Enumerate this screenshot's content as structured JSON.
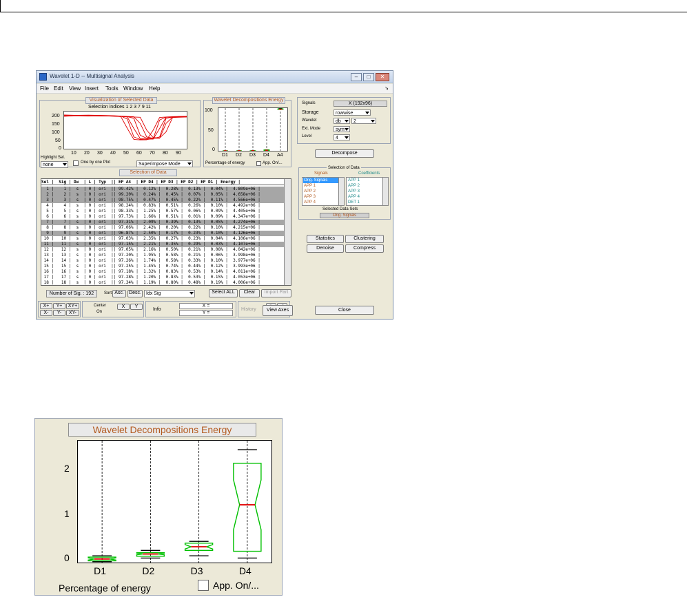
{
  "window": {
    "title": "Wavelet 1-D -- Multisignal Analysis",
    "controls": [
      "–",
      "□",
      "✕"
    ],
    "menu": [
      "File",
      "Edit",
      "View",
      "Insert",
      "Tools",
      "Window",
      "Help"
    ],
    "menu_corner": "↘"
  },
  "visualization": {
    "title": "Visualization of Selected Data",
    "indices_label": "Selection indices 1  2  3  7  9 11",
    "y_ticks": [
      "200",
      "150",
      "100",
      "50",
      "0"
    ],
    "x_ticks": [
      "10",
      "20",
      "30",
      "40",
      "50",
      "60",
      "70",
      "80",
      "90"
    ],
    "highlight_label": "Highlight Sel.",
    "highlight_value": "none",
    "one_by_one_label": "One by one Plot",
    "mode_value": "Superimpose Mode"
  },
  "energy_small": {
    "title": "Wavelet Decompositions Energy",
    "y_ticks": [
      "100",
      "50",
      "0"
    ],
    "x_ticks": [
      "D1",
      "D2",
      "D3",
      "D4",
      "A4"
    ],
    "xlabel": "Percentage of energy",
    "app_label": "App. On/..."
  },
  "data_selection": {
    "title": "Selection of Data",
    "header": "Sel |  Sig | Dw  | L | Typ  || EP A4  | EP D4 | EP D3 | EP D2 | EP D1 | Energy |",
    "rows": [
      {
        "text": "  1 |    1 |  s  | 0 | ori  || 99.42% |  0.12% |  0.28% |  0.13% |  0.04% |  4.809e+06 |",
        "sel": true
      },
      {
        "text": "  2 |    2 |  s  | 0 | ori  || 99.20% |  0.24% |  0.45% |  0.07% |  0.05% |  4.658e+06 |",
        "sel": true
      },
      {
        "text": "  3 |    3 |  s  | 0 | ori  || 98.75% |  0.47% |  0.45% |  0.22% |  0.11% |  4.566e+06 |",
        "sel": true
      },
      {
        "text": "  4 |    4 |  s  | 0 | ori  || 98.24% |  0.83% |  0.51% |  0.26% |  0.10% |  4.492e+06 |",
        "sel": false
      },
      {
        "text": "  5 |    5 |  s  | 0 | ori  || 98.33% |  1.25% |  0.57% |  0.06% |  0.09% |  4.405e+06 |",
        "sel": false
      },
      {
        "text": "  6 |    6 |  s  | 0 | ori  || 97.73% |  1.66% |  0.51% |  0.01% |  0.09% |  4.347e+06 |",
        "sel": false
      },
      {
        "text": "  7 |    7 |  s  | 0 | ori  || 97.31% |  2.09% |  0.39% |  0.13% |  0.05% |  4.274e+06 |",
        "sel": true
      },
      {
        "text": "  8 |    8 |  s  | 0 | ori  || 97.06% |  2.42% |  0.20% |  0.22% |  0.10% |  4.215e+06 |",
        "sel": false
      },
      {
        "text": "  9 |    9 |  s  | 0 | ori  || 96.87% |  2.50% |  0.17% |  0.23% |  0.10% |  4.126e+06 |",
        "sel": true
      },
      {
        "text": " 10 |   10 |  s  | 0 | ori  || 97.03% |  2.35% |  0.27% |  0.23% |  0.04% |  4.106e+06 |",
        "sel": false
      },
      {
        "text": " 11 |   11 |  s  | 0 | ori  || 97.15% |  2.21% |  0.35% |  0.29% |  0.03% |  4.107e+06 |",
        "sel": true
      },
      {
        "text": " 12 |   12 |  s  | 0 | ori  || 97.05% |  2.16% |  0.50% |  0.21% |  0.08% |  4.042e+06 |",
        "sel": false
      },
      {
        "text": " 13 |   13 |  s  | 0 | ori  || 97.20% |  1.95% |  0.58% |  0.21% |  0.06% |  3.998e+06 |",
        "sel": false
      },
      {
        "text": " 14 |   14 |  s  | 0 | ori  || 97.26% |  1.74% |  0.58% |  0.33% |  0.10% |  3.977e+06 |",
        "sel": false
      },
      {
        "text": " 15 |   15 |  s  | 0 | ori  || 97.25% |  1.45% |  0.74% |  0.44% |  0.12% |  3.993e+06 |",
        "sel": false
      },
      {
        "text": " 16 |   16 |  s  | 0 | ori  || 97.18% |  1.32% |  0.83% |  0.53% |  0.14% |  4.011e+06 |",
        "sel": false
      },
      {
        "text": " 17 |   17 |  s  | 0 | ori  || 97.28% |  1.20% |  0.83% |  0.53% |  0.15% |  4.053e+06 |",
        "sel": false
      },
      {
        "text": " 18 |   18 |  s  | 0 | ori  || 97.34% |  1.19% |  0.80% |  0.48% |  0.19% |  4.006e+06 |",
        "sel": false
      }
    ],
    "num_sig_label": "Number of Sig. : 192",
    "sort_label": "Sort",
    "asc_label": "Asc.",
    "desc_label": "Desc.",
    "sort_value": "Idx Sig",
    "select_all": "Select ALL",
    "clear": "Clear",
    "import_part": "Import Part"
  },
  "bottom_tools": {
    "xplus": "X+",
    "yplus": "Y+",
    "xyplus": "XY+",
    "xminus": "X-",
    "yminus": "Y-",
    "xyminus": "XY-",
    "center_label": "Center",
    "center_sub": "On",
    "c_x": "X",
    "c_y": "Y",
    "info_label": "Info",
    "info_x": "X =",
    "info_y": "Y =",
    "history_label": "History",
    "hist_back": "<-",
    "hist_fwd": "->",
    "hist_all": "<<-",
    "view_axes": "View Axes"
  },
  "right_panel": {
    "signals_label": "Signals",
    "signals_value": "X (192x96)",
    "storage_label": "Storage",
    "storage_value": "rowwise",
    "wavelet_label": "Wavelet",
    "wavelet_family": "db",
    "wavelet_number": "2",
    "extmode_label": "Ext. Mode",
    "extmode_value": "sym",
    "level_label": "Level",
    "level_value": "4",
    "decompose": "Decompose",
    "selection_title": "Selection of Data",
    "signals_col": "Signals",
    "coeffs_col": "Coefficients",
    "signals_list": [
      "Orig. Signals",
      "APP 1",
      "APP 2",
      "APP 3",
      "APP 4"
    ],
    "coeffs_list": [
      "APP 1",
      "APP 2",
      "APP 3",
      "APP 4",
      "DET 1"
    ],
    "selected_sets_label": "Selected Data Sets",
    "selected_sets_value": "Orig. Signals",
    "statistics": "Statistics",
    "clustering": "Clustering",
    "denoise": "Denoise",
    "compress": "Compress",
    "close": "Close"
  },
  "energy_zoom": {
    "title": "Wavelet Decompositions Energy",
    "y_ticks": [
      "2",
      "1",
      "0"
    ],
    "x_ticks": [
      "D1",
      "D2",
      "D3",
      "D4"
    ],
    "xlabel": "Percentage of energy",
    "app_label": "App. On/..."
  },
  "colors": {
    "panel_bg": "#ece9d8",
    "title_orange": "#b35a1f",
    "box_green": "#00c000",
    "median_red": "#e00000",
    "signal_red": "#e00000",
    "selected_row": "#a6a6a6",
    "highlight_blue": "#3399ff"
  },
  "chart_data": [
    {
      "type": "line",
      "x": [
        1,
        10,
        20,
        30,
        40,
        45,
        50,
        55,
        60,
        65,
        70,
        75,
        80,
        85,
        90,
        96
      ],
      "xlim": [
        1,
        96
      ],
      "ylim": [
        0,
        220
      ],
      "grid": false,
      "series": [
        {
          "values": [
            195,
            197,
            196,
            194,
            193,
            190,
            120,
            55,
            52,
            53,
            110,
            185,
            188,
            186,
            189,
            190
          ]
        },
        {
          "values": [
            200,
            198,
            199,
            197,
            195,
            193,
            175,
            70,
            55,
            54,
            60,
            170,
            188,
            190,
            191,
            192
          ]
        },
        {
          "values": [
            192,
            195,
            193,
            195,
            192,
            191,
            188,
            120,
            60,
            58,
            57,
            120,
            186,
            188,
            187,
            189
          ]
        },
        {
          "values": [
            196,
            197,
            195,
            196,
            194,
            192,
            190,
            180,
            80,
            62,
            60,
            70,
            180,
            187,
            188,
            190
          ]
        },
        {
          "values": [
            194,
            196,
            196,
            193,
            194,
            193,
            191,
            189,
            150,
            70,
            62,
            62,
            150,
            186,
            186,
            188
          ]
        },
        {
          "values": [
            198,
            196,
            197,
            195,
            193,
            192,
            190,
            188,
            186,
            110,
            66,
            64,
            100,
            184,
            187,
            189
          ]
        }
      ]
    },
    {
      "type": "box",
      "categories": [
        "D1",
        "D2",
        "D3",
        "D4",
        "A4"
      ],
      "ylim": [
        0,
        100
      ],
      "xlabel": "Percentage of energy",
      "boxes": [
        {
          "min": 0.02,
          "q1": 0.04,
          "median": 0.08,
          "q3": 0.12,
          "max": 0.15
        },
        {
          "min": 0.1,
          "q1": 0.14,
          "median": 0.19,
          "q3": 0.22,
          "max": 0.27
        },
        {
          "min": 0.15,
          "q1": 0.27,
          "median": 0.35,
          "q3": 0.43,
          "max": 0.47
        },
        {
          "min": 0.1,
          "q1": 0.25,
          "median": 1.28,
          "q3": 2.2,
          "max": 2.5
        },
        {
          "min": 96.9,
          "q1": 97.1,
          "median": 97.3,
          "q3": 98.2,
          "max": 99.4
        }
      ]
    },
    {
      "type": "box",
      "categories": [
        "D1",
        "D2",
        "D3",
        "D4"
      ],
      "ylim": [
        0,
        2.7
      ],
      "xlabel": "Percentage of energy",
      "boxes": [
        {
          "min": 0.02,
          "q1": 0.04,
          "median": 0.08,
          "q3": 0.12,
          "max": 0.15
        },
        {
          "min": 0.1,
          "q1": 0.14,
          "median": 0.19,
          "q3": 0.22,
          "max": 0.27
        },
        {
          "min": 0.15,
          "q1": 0.27,
          "median": 0.35,
          "q3": 0.43,
          "max": 0.47
        },
        {
          "min": 0.1,
          "q1": 0.25,
          "median": 1.28,
          "q3": 2.2,
          "max": 2.5
        }
      ]
    }
  ]
}
